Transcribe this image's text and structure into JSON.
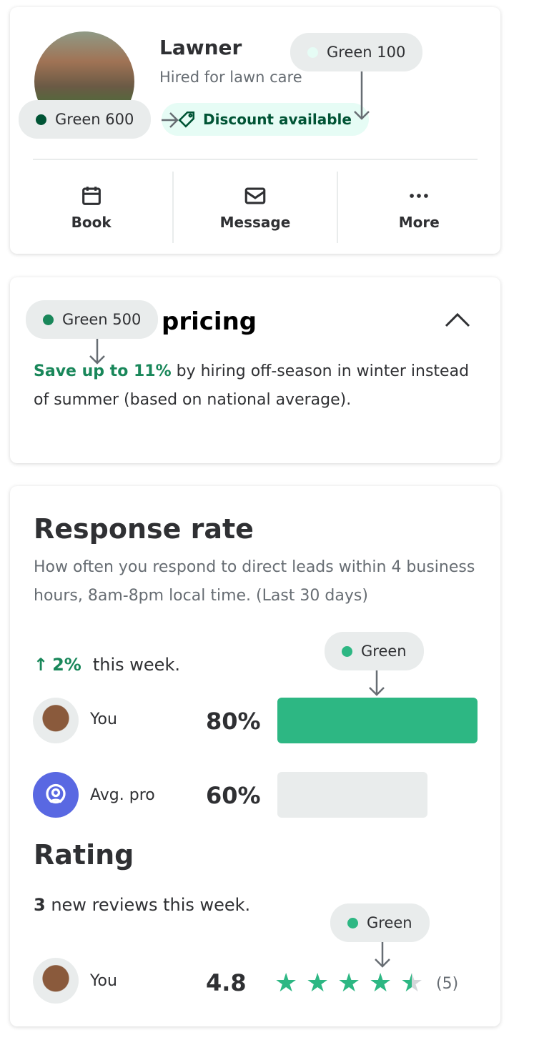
{
  "pro": {
    "name": "Lawner",
    "subtitle": "Hired for lawn care",
    "badge": "Discount available"
  },
  "actions": [
    {
      "label": "Book",
      "icon": "calendar-icon"
    },
    {
      "label": "Message",
      "icon": "mail-icon"
    },
    {
      "label": "More",
      "icon": "more-dots-icon"
    }
  ],
  "annotations": {
    "green100": "Green 100",
    "green600": "Green 600",
    "green500": "Green 500",
    "green_bar": "Green",
    "green_stars": "Green"
  },
  "colors": {
    "green100": "#e6fcf5",
    "green600": "#005435",
    "green500": "#19875a",
    "green": "#2db783",
    "gray": "#e9ecec",
    "avatar_purple": "#5968e2"
  },
  "pricing": {
    "title": "pricing",
    "highlight": "Save up to 11%",
    "body": " by hiring off-season in winter instead of summer (based on national average)."
  },
  "response": {
    "title": "Response rate",
    "description": "How often you respond to direct leads within 4 business hours, 8am-8pm local time. (Last 30 days)",
    "change": "2%",
    "change_suffix": "this week.",
    "rows": [
      {
        "label": "You",
        "value": "80%",
        "percent": 80
      },
      {
        "label": "Avg. pro",
        "value": "60%",
        "percent": 60
      }
    ]
  },
  "rating": {
    "title": "Rating",
    "count": "3",
    "count_suffix": " new reviews this week.",
    "label": "You",
    "value": "4.8",
    "stars": 4.5,
    "reviews": "(5)"
  }
}
